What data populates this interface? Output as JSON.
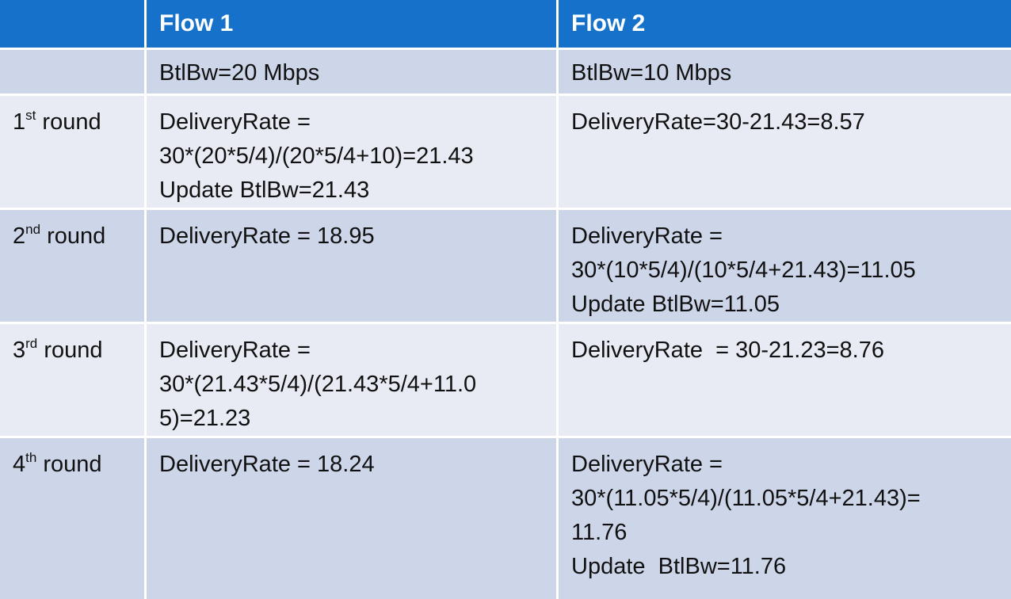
{
  "header": {
    "col0": "",
    "col1": "Flow 1",
    "col2": "Flow 2"
  },
  "rows": [
    {
      "label_num": "",
      "label_sup": "",
      "label_rest": "",
      "flow1": [
        "BtlBw=20 Mbps"
      ],
      "flow2": [
        "BtlBw=10 Mbps"
      ]
    },
    {
      "label_num": "1",
      "label_sup": "st",
      "label_rest": " round",
      "flow1": [
        "DeliveryRate =",
        "30*(20*5/4)/(20*5/4+10)=21.43",
        "Update BtlBw=21.43"
      ],
      "flow2": [
        "DeliveryRate=30-21.43=8.57"
      ]
    },
    {
      "label_num": "2",
      "label_sup": "nd",
      "label_rest": " round",
      "flow1": [
        "DeliveryRate = 18.95"
      ],
      "flow2": [
        "DeliveryRate =",
        "30*(10*5/4)/(10*5/4+21.43)=11.05",
        "Update BtlBw=11.05"
      ]
    },
    {
      "label_num": "3",
      "label_sup": "rd",
      "label_rest": " round",
      "flow1": [
        "DeliveryRate =",
        "30*(21.43*5/4)/(21.43*5/4+11.0",
        "5)=21.23"
      ],
      "flow2": [
        "DeliveryRate  = 30-21.23=8.76"
      ]
    },
    {
      "label_num": "4",
      "label_sup": "th",
      "label_rest": " round",
      "flow1": [
        "DeliveryRate = 18.24"
      ],
      "flow2": [
        "DeliveryRate =",
        "30*(11.05*5/4)/(11.05*5/4+21.43)=",
        "11.76",
        "Update  BtlBw=11.76"
      ]
    }
  ]
}
